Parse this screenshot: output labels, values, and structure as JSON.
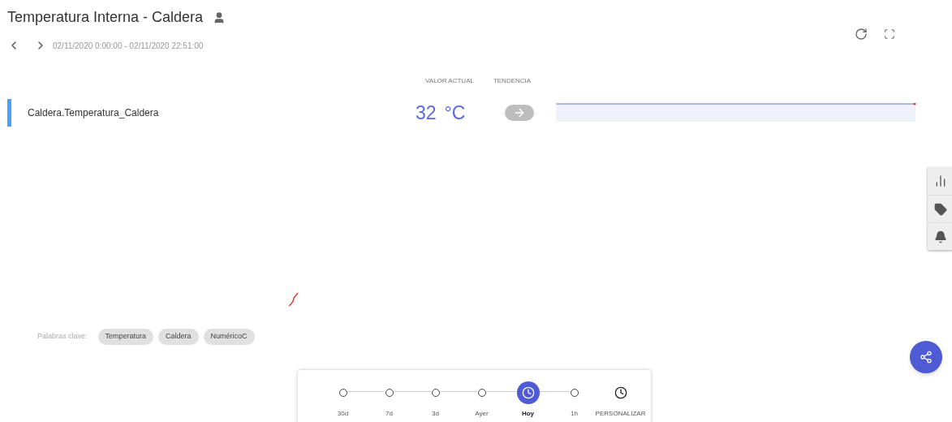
{
  "title": "Temperatura Interna - Caldera",
  "date_range": "02/11/2020 0:00:00 - 02/11/2020 22:51:00",
  "columns": {
    "current_value": "VALOR ACTUAL",
    "trend": "TENDENCIA"
  },
  "signal": {
    "name": "Caldera.Temperatura_Caldera",
    "color": "#42a5f5",
    "value": "32",
    "unit": "°C"
  },
  "keywords": {
    "label": "Palabras clave:",
    "tags": [
      "Temperatura",
      "Caldera",
      "NuméricoC"
    ]
  },
  "side_tools": [
    {
      "kind": "chart"
    },
    {
      "kind": "tag"
    },
    {
      "kind": "bell"
    }
  ],
  "timeline": [
    {
      "label": "30d",
      "kind": "step",
      "selected": false
    },
    {
      "label": "7d",
      "kind": "step",
      "selected": false
    },
    {
      "label": "3d",
      "kind": "step",
      "selected": false
    },
    {
      "label": "Ayer",
      "kind": "step",
      "selected": false
    },
    {
      "label": "Hoy",
      "kind": "step",
      "selected": true
    },
    {
      "label": "1h",
      "kind": "step",
      "selected": false
    },
    {
      "label": "PERSONALIZAR",
      "kind": "custom",
      "selected": false
    }
  ]
}
